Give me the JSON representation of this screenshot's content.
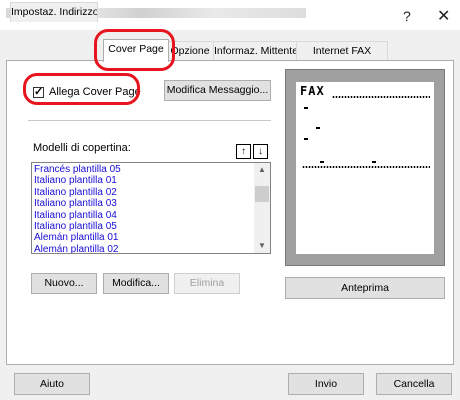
{
  "window": {
    "help_glyph": "?",
    "close_glyph": "✕"
  },
  "tabs": [
    {
      "label": "Impostaz. Indirizzo",
      "active": false
    },
    {
      "label": "Cover Page",
      "active": true
    },
    {
      "label": "Opzione",
      "active": false
    },
    {
      "label": "Informaz. Mittente",
      "active": false
    },
    {
      "label": "Internet FAX",
      "active": false
    }
  ],
  "cover_page": {
    "attach_checkbox_label": "Allega Cover Page",
    "attach_checked": true,
    "edit_message_button": "Modifica Messaggio...",
    "templates_label": "Modelli di copertina:",
    "move_up_icon": "arrow-up-icon",
    "move_down_icon": "arrow-down-icon",
    "templates": [
      "Francés plantilla 05",
      "Italiano plantilla 01",
      "Italiano plantilla 02",
      "Italiano plantilla 03",
      "Italiano plantilla 04",
      "Italiano plantilla 05",
      "Alemán plantilla 01",
      "Alemán plantilla 02"
    ],
    "new_button": "Nuovo...",
    "edit_button": "Modifica...",
    "delete_button": "Elimina",
    "preview_button": "Anteprima",
    "preview_heading": "FAX"
  },
  "footer": {
    "help_button": "Aiuto",
    "send_button": "Invio",
    "cancel_button": "Cancella"
  },
  "colors": {
    "highlight_circle": "#e8141e",
    "template_text": "#1a0dd6",
    "preview_frame": "#a0a0a0"
  }
}
